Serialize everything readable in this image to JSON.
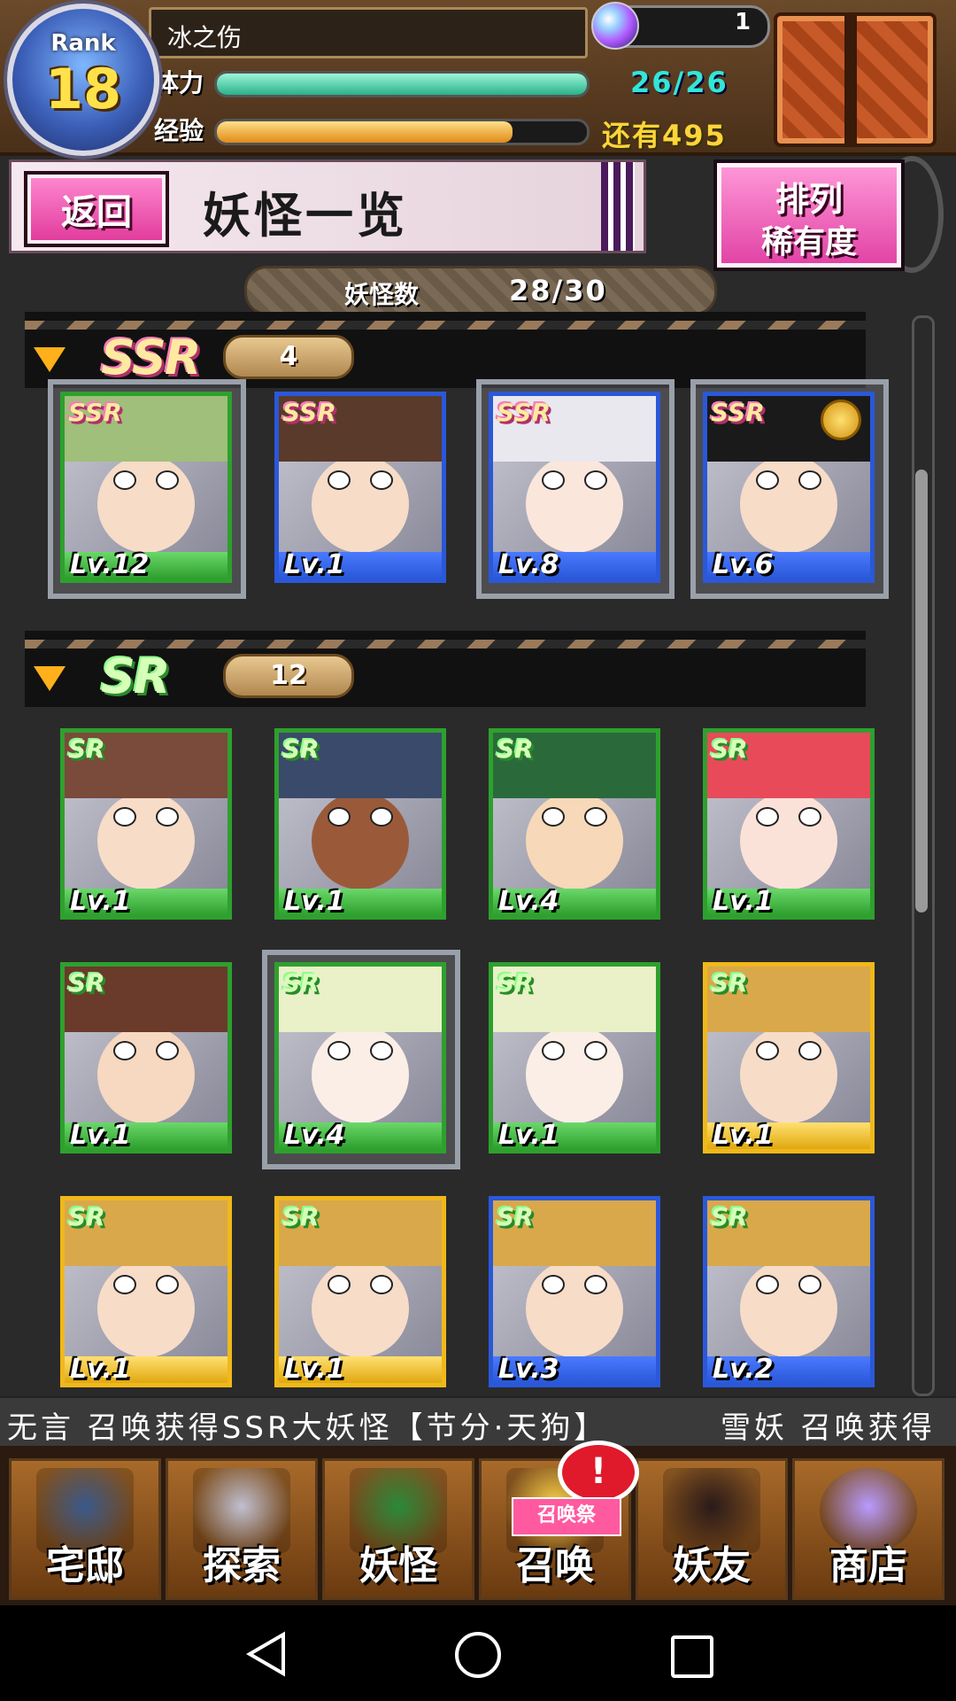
{
  "hud": {
    "rank_label": "Rank",
    "rank_value": "18",
    "player_name": "冰之伤",
    "stamina_label": "体力",
    "stamina_value": "26/26",
    "stamina_fraction": 1.0,
    "exp_label": "经验",
    "exp_value": "还有495",
    "exp_fraction": 0.8,
    "orb_count": "1"
  },
  "title_bar": {
    "back_label": "返回",
    "title": "妖怪一览",
    "sort_line1": "排列",
    "sort_line2": "稀有度"
  },
  "counter": {
    "label": "妖怪数",
    "value": "28/30"
  },
  "sections": [
    {
      "rarity": "SSR",
      "count": "4",
      "cards": [
        {
          "level": "Lv.12",
          "frame": "green",
          "hair": "#9fbf7a",
          "skin": "#f7dcc8"
        },
        {
          "level": "Lv.1",
          "frame": "blue",
          "hair": "#5a3a2a",
          "skin": "#f7dcc8"
        },
        {
          "level": "Lv.8",
          "frame": "blue",
          "hair": "#e8e8ee",
          "skin": "#fbe6dc"
        },
        {
          "level": "Lv.6",
          "frame": "blue",
          "hair": "#1a1a1a",
          "skin": "#f7dcc8"
        }
      ]
    },
    {
      "rarity": "SR",
      "count": "12",
      "cards": [
        {
          "level": "Lv.1",
          "frame": "green",
          "hair": "#7a4a3a",
          "skin": "#f7dcc8"
        },
        {
          "level": "Lv.1",
          "frame": "green",
          "hair": "#3a4a6a",
          "skin": "#9a5a3a"
        },
        {
          "level": "Lv.4",
          "frame": "green",
          "hair": "#2a6a3a",
          "skin": "#f7d8b8"
        },
        {
          "level": "Lv.1",
          "frame": "green",
          "hair": "#e84a5a",
          "skin": "#fbe2d8"
        },
        {
          "level": "Lv.1",
          "frame": "green",
          "hair": "#6a3a2a",
          "skin": "#f7d8c0"
        },
        {
          "level": "Lv.4",
          "frame": "green",
          "hair": "#eaf0c8",
          "skin": "#fbeee6"
        },
        {
          "level": "Lv.1",
          "frame": "green",
          "hair": "#eaf0c8",
          "skin": "#fbeee6"
        },
        {
          "level": "Lv.1",
          "frame": "gold",
          "hair": "#d9a84a",
          "skin": "#f7dcc8"
        },
        {
          "level": "Lv.1",
          "frame": "gold",
          "hair": "#d9a84a",
          "skin": "#f7dcc8"
        },
        {
          "level": "Lv.1",
          "frame": "gold",
          "hair": "#d9a84a",
          "skin": "#f7dcc8"
        },
        {
          "level": "Lv.3",
          "frame": "blue",
          "hair": "#d9a84a",
          "skin": "#f7dcc8"
        },
        {
          "level": "Lv.2",
          "frame": "blue",
          "hair": "#d9a84a",
          "skin": "#f7dcc8"
        }
      ]
    }
  ],
  "ticker": {
    "segment1": "无言 召唤获得SSR大妖怪【节分·天狗】",
    "segment2": "雪妖 召唤获得"
  },
  "bottom_nav": [
    {
      "label": "宅邸",
      "icon": "house-icon"
    },
    {
      "label": "探索",
      "icon": "magnifier-icon"
    },
    {
      "label": "妖怪",
      "icon": "scroll-icon"
    },
    {
      "label": "召唤",
      "icon": "star-icon"
    },
    {
      "label": "妖友",
      "icon": "friend-icon"
    },
    {
      "label": "商店",
      "icon": "crystal-ball-icon"
    }
  ],
  "summon_badge": "召唤祭",
  "alert": "!",
  "colors": {
    "frame_green": "#2ea02e",
    "frame_blue": "#2a58d8",
    "frame_gold": "#f0b81a",
    "accent_pink": "#e0389a"
  }
}
